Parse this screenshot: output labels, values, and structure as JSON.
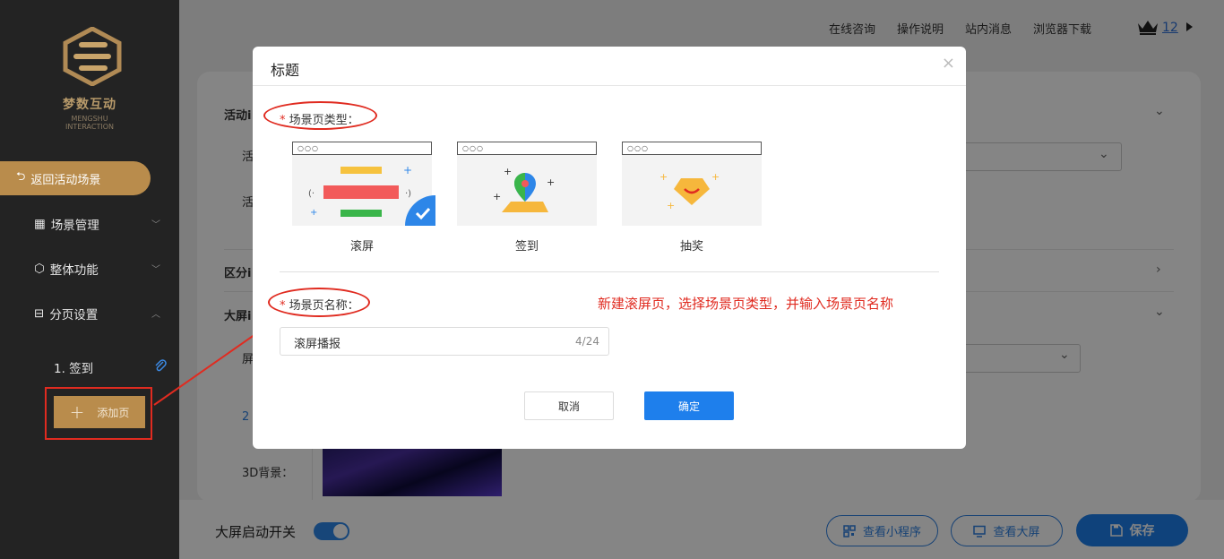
{
  "brand": {
    "name": "梦数互动",
    "subtitle": "MENGSHU INTERACTION"
  },
  "sidebar": {
    "back_label": "返回活动场景",
    "items": [
      {
        "label": "场景管理",
        "icon": "grid-icon"
      },
      {
        "label": "整体功能",
        "icon": "cube-icon"
      },
      {
        "label": "分页设置",
        "icon": "layout-icon"
      }
    ],
    "pages": [
      {
        "label": "1. 签到"
      }
    ],
    "add_page_label": "添加页"
  },
  "topbar": {
    "links": [
      "在线咨询",
      "操作说明",
      "站内消息",
      "浏览器下载"
    ],
    "vip_level": "12"
  },
  "content": {
    "section1_label": "活动i",
    "field1_label": "活",
    "field2_label": "活",
    "section2_label": "区分i",
    "section3_label": "大屏i",
    "field3_label": "屏",
    "field4_label": "2",
    "bg3d_label": "3D背景："
  },
  "bottombar": {
    "switch_label": "大屏启动开关",
    "switch_on": true,
    "mini_program_label": "查看小程序",
    "big_screen_label": "查看大屏",
    "save_label": "保存"
  },
  "dialog": {
    "title": "标题",
    "close": "×",
    "type_label": "场景页类型：",
    "required_mark": "*",
    "types": [
      {
        "name": "滚屏",
        "selected": true
      },
      {
        "name": "签到",
        "selected": false
      },
      {
        "name": "抽奖",
        "selected": false
      }
    ],
    "name_label": "场景页名称：",
    "hint": "新建滚屏页，选择场景页类型，并输入场景页名称",
    "name_value": "滚屏播报",
    "name_count": "4/24",
    "cancel_label": "取消",
    "ok_label": "确定"
  },
  "colors": {
    "accent": "#1e7fec",
    "gold": "#b98c4c",
    "annotation": "#e02b20"
  }
}
